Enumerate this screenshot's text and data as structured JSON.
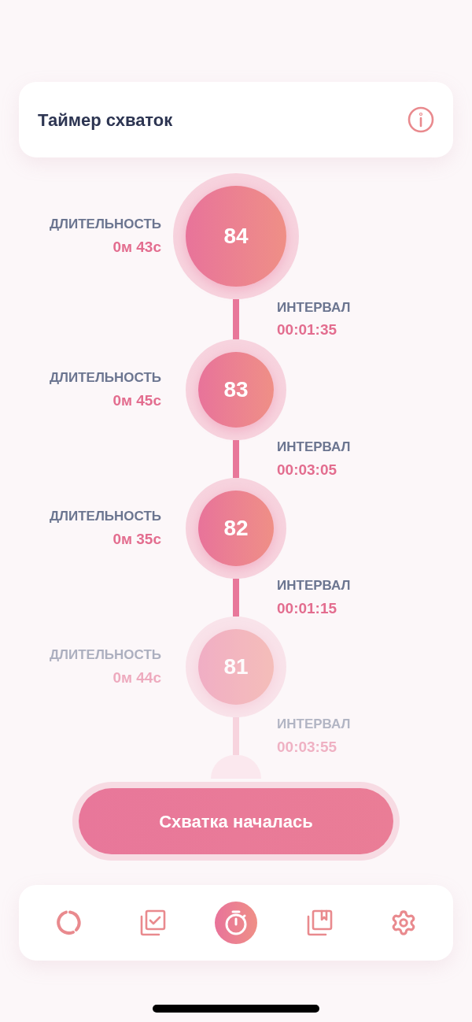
{
  "header": {
    "title": "Таймер схваток"
  },
  "contractions": [
    {
      "number": "84",
      "duration_label": "ДЛИТЕЛЬНОСТЬ",
      "duration": "0м 43с",
      "interval_label": "ИНТЕРВАЛ",
      "interval": "00:01:35"
    },
    {
      "number": "83",
      "duration_label": "ДЛИТЕЛЬНОСТЬ",
      "duration": "0м 45с",
      "interval_label": "ИНТЕРВАЛ",
      "interval": "00:03:05"
    },
    {
      "number": "82",
      "duration_label": "ДЛИТЕЛЬНОСТЬ",
      "duration": "0м 35с",
      "interval_label": "ИНТЕРВАЛ",
      "interval": "00:01:15"
    },
    {
      "number": "81",
      "duration_label": "ДЛИТЕЛЬНОСТЬ",
      "duration": "0м 44с",
      "interval_label": "ИНТЕРВАЛ",
      "interval": "00:03:55"
    }
  ],
  "start_button": {
    "label": "Схватка началась"
  },
  "nav": [
    {
      "kind": "progress",
      "selected": false
    },
    {
      "kind": "checklist",
      "selected": false
    },
    {
      "kind": "timer",
      "selected": true
    },
    {
      "kind": "bookmarks",
      "selected": false
    },
    {
      "kind": "settings",
      "selected": false
    }
  ]
}
